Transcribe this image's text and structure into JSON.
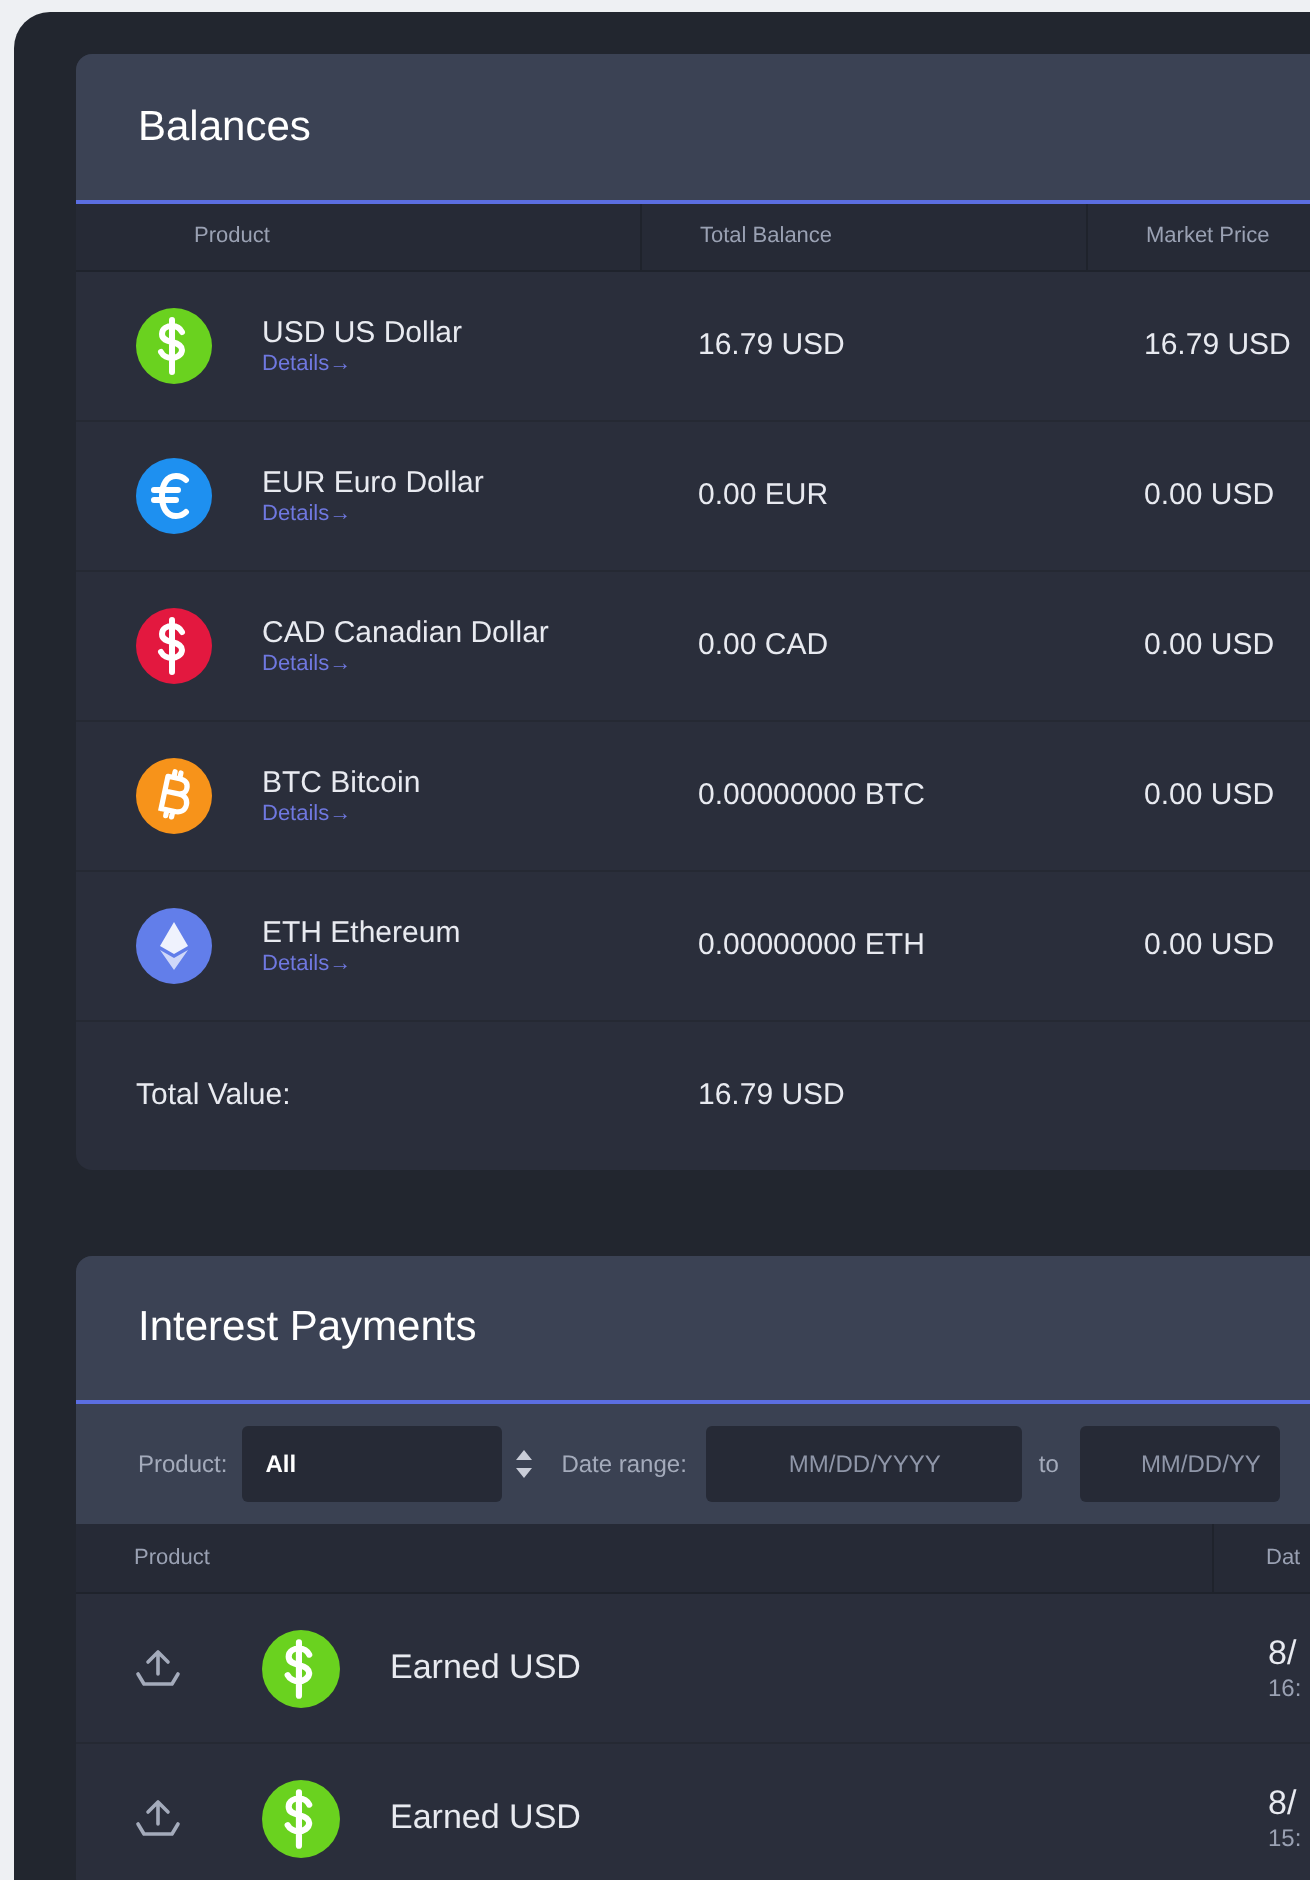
{
  "balances": {
    "title": "Balances",
    "columns": [
      "Product",
      "Total Balance",
      "Market Price"
    ],
    "rows": [
      {
        "kind": "dollar",
        "color": "#6ad21f",
        "name": "USD US Dollar",
        "link": "Details→",
        "total": "16.79 USD",
        "price": "16.79 USD"
      },
      {
        "kind": "euro",
        "color": "#1e90f0",
        "name": "EUR Euro Dollar",
        "link": "Details→",
        "total": "0.00 EUR",
        "price": "0.00 USD"
      },
      {
        "kind": "dollar",
        "color": "#e3183f",
        "name": "CAD Canadian Dollar",
        "link": "Details→",
        "total": "0.00 CAD",
        "price": "0.00 USD"
      },
      {
        "kind": "bitcoin",
        "color": "#f7931a",
        "name": "BTC Bitcoin",
        "link": "Details→",
        "total": "0.00000000 BTC",
        "price": "0.00 USD"
      },
      {
        "kind": "ethereum",
        "color": "#627eea",
        "name": "ETH Ethereum",
        "link": "Details→",
        "total": "0.00000000 ETH",
        "price": "0.00 USD"
      }
    ],
    "total_label": "Total Value:",
    "total_value": "16.79 USD"
  },
  "interest": {
    "title": "Interest Payments",
    "filters": {
      "product_label": "Product:",
      "product_value": "All",
      "date_label": "Date range:",
      "from_placeholder": "MM/DD/YYYY",
      "to_label": "to",
      "to_placeholder": "MM/DD/YY"
    },
    "columns": [
      "Product",
      "Dat"
    ],
    "rows": [
      {
        "kind": "dollar",
        "color": "#6ad21f",
        "name": "Earned USD",
        "date": "8/",
        "time": "16:"
      },
      {
        "kind": "dollar",
        "color": "#6ad21f",
        "name": "Earned USD",
        "date": "8/",
        "time": "15:"
      }
    ]
  }
}
